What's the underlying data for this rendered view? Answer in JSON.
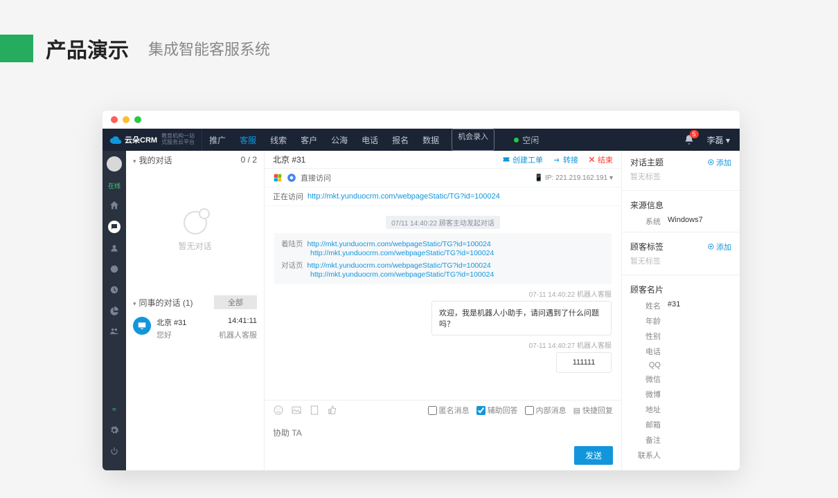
{
  "slide": {
    "title": "产品演示",
    "subtitle": "集成智能客服系统"
  },
  "topbar": {
    "logo": "云朵CRM",
    "logo_sub1": "教育机构一站",
    "logo_sub2": "式服务云平台",
    "nav": [
      "推广",
      "客服",
      "线索",
      "客户",
      "公海",
      "电话",
      "报名",
      "数据"
    ],
    "active": 1,
    "record": "机会录入",
    "status": "空闲",
    "badge": "5",
    "user": "李磊"
  },
  "leftbar": {
    "status": "在线"
  },
  "list": {
    "my_title": "我的对话",
    "my_count": "0 / 2",
    "empty": "暂无对话",
    "col_title": "同事的对话",
    "col_count": "(1)",
    "all": "全部",
    "conv": {
      "name": "北京 #31",
      "msg": "您好",
      "time": "14:41:11",
      "agent": "机器人客服"
    }
  },
  "chat": {
    "title": "北京 #31",
    "actions": {
      "ticket": "创建工单",
      "transfer": "转接",
      "end": "结束"
    },
    "access_type": "直接访问",
    "ip_label": "IP:",
    "ip": "221.219.162.191",
    "visiting_label": "正在访问",
    "visiting_url": "http://mkt.yunduocrm.com/webpageStatic/TG?id=100024",
    "sys_tag": "07/11 14:40:22  顾客主动发起对话",
    "landing_label": "着陆页",
    "dialog_label": "对话页",
    "url": "http://mkt.yunduocrm.com/webpageStatic/TG?id=100024",
    "ts1": "07-11 14:40:22  机器人客服",
    "bubble1": "欢迎，我是机器人小助手，请问遇到了什么问题吗？",
    "ts2": "07-11 14:40:27  机器人客服",
    "bubble2": "111111",
    "opt_anon": "匿名消息",
    "opt_assist": "辅助回答",
    "opt_internal": "内部消息",
    "opt_quick": "快捷回复",
    "placeholder": "协助 TA",
    "send": "发送"
  },
  "side": {
    "topic_title": "对话主题",
    "add": "添加",
    "no_tag": "暂无标签",
    "source_title": "来源信息",
    "sys_label": "系统",
    "sys_val": "Windows7",
    "tags_title": "顾客标签",
    "card_title": "顾客名片",
    "fields": [
      {
        "k": "姓名",
        "v": "#31"
      },
      {
        "k": "年龄",
        "v": ""
      },
      {
        "k": "性别",
        "v": ""
      },
      {
        "k": "电话",
        "v": ""
      },
      {
        "k": "QQ",
        "v": ""
      },
      {
        "k": "微信",
        "v": ""
      },
      {
        "k": "微博",
        "v": ""
      },
      {
        "k": "地址",
        "v": ""
      },
      {
        "k": "邮箱",
        "v": ""
      },
      {
        "k": "备注",
        "v": ""
      },
      {
        "k": "联系人",
        "v": ""
      }
    ]
  }
}
